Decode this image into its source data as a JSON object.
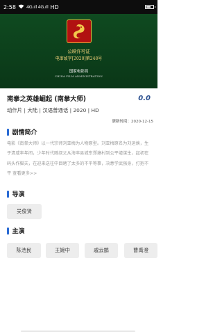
{
  "status_bar": {
    "time": "2:58",
    "icons": [
      "wifi-icon",
      "signal-icon",
      "signal-icon",
      "hd-icon",
      "battery-icon"
    ],
    "signal_text": "4G.ıll 4G.ıll",
    "hd_label": "HD"
  },
  "video": {
    "permit_title": "公映许可证",
    "permit_number": "电审故字[2020]第248号",
    "issuer_cn": "国家电影局",
    "issuer_en": "CHINA FILM ADMINISTRATION",
    "logo_icon": "dragon-emblem-icon"
  },
  "movie": {
    "title": "南拳之英雄崛起 (南拳大师)",
    "score": "0.0",
    "meta": "动作片 | 大陆 | 汉语普通话 | 2020 | HD",
    "updated": "更新时间：2020-12-15"
  },
  "plot": {
    "heading": "剧情简介",
    "text": "电影《南拳大师》以一代宗师刘亚梅为人物原型。刘亚梅原名为刘运焕，生于清咸丰年间，少年时代随叔父从海丰县城东郑塘村到公平墟谋生，起初在码头作脚夫，在迎来送往中目睹了太多的不平等事，决意学武强身，打抱不平",
    "more": "查看更多>>"
  },
  "director": {
    "heading": "导演",
    "names": [
      "吴俊贤"
    ]
  },
  "cast": {
    "heading": "主演",
    "names": [
      "陈浩民",
      "王婉中",
      "戚云鹏",
      "曹禹澄"
    ]
  },
  "colors": {
    "accent": "#2a6bd4",
    "score": "#2a4f8f",
    "video_bg": "#0f4a20"
  }
}
